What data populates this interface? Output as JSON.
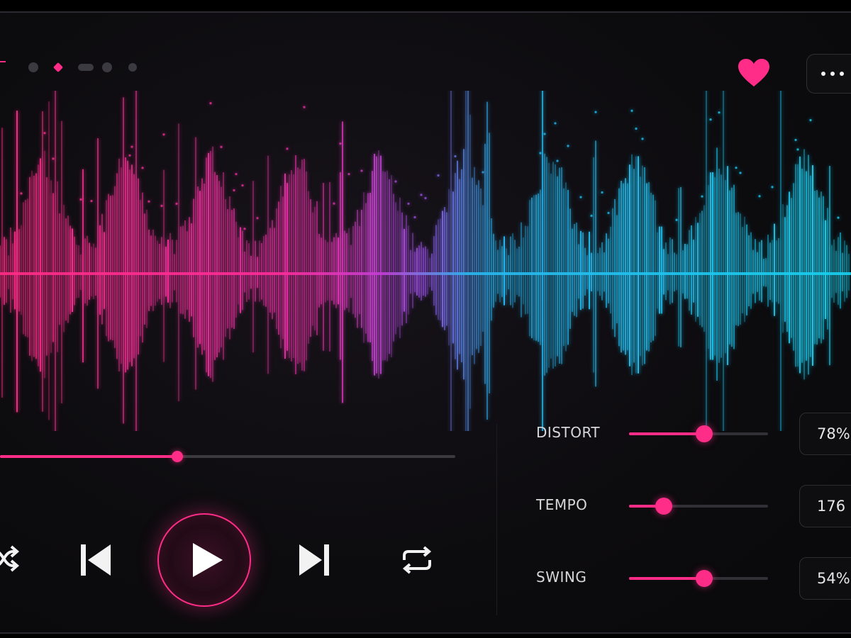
{
  "colors": {
    "accent": "#ff2d87",
    "cyan": "#19d2f0",
    "magenta": "#c33fd8",
    "background": "#0c0b0e"
  },
  "header": {
    "page_dots": {
      "count": 5,
      "active_index": 1
    },
    "favorite": {
      "icon": "heart-icon",
      "active": true
    },
    "more": {
      "icon": "more-horizontal-icon"
    }
  },
  "player": {
    "progress": 0.39,
    "controls": {
      "shuffle_icon": "shuffle-icon",
      "previous_icon": "skip-previous-icon",
      "play_icon": "play-icon",
      "next_icon": "skip-next-icon",
      "repeat_icon": "repeat-icon"
    }
  },
  "params": [
    {
      "label": "DISTORT",
      "value_text": "78%",
      "level": 0.54
    },
    {
      "label": "TEMPO",
      "value_text": "176",
      "level": 0.25
    },
    {
      "label": "SWING",
      "value_text": "54%",
      "level": 0.54
    }
  ]
}
